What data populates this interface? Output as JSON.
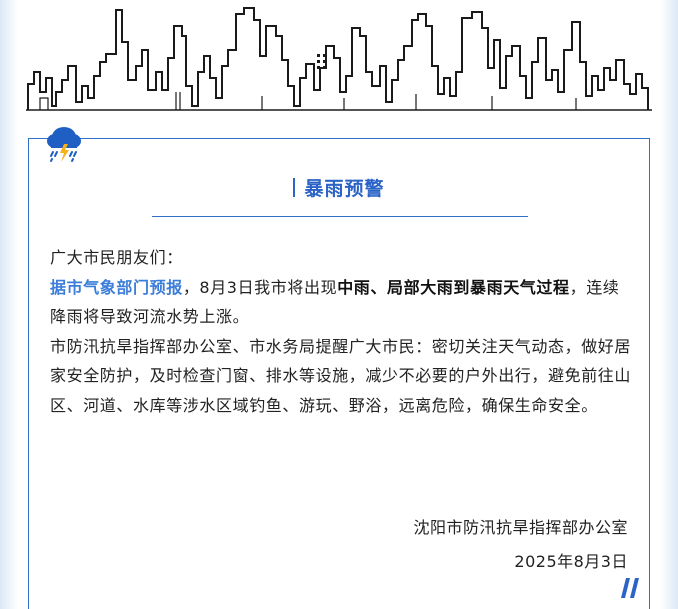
{
  "notice": {
    "title": "暴雨预警",
    "greeting": "广大市民朋友们：",
    "para1": {
      "highlight": "据市气象部门预报",
      "text_a": "，8月3日我市将出现",
      "bold": "中雨、局部大雨到暴雨天气过程",
      "text_b": "，连续降雨将导致河流水势上涨。"
    },
    "para2": "市防汛抗旱指挥部办公室、市水务局提醒广大市民：密切关注天气动态，做好居家安全防护，及时检查门窗、排水等设施，减少不必要的户外出行，避免前往山区、河道、水库等涉水区域钓鱼、游玩、野浴，远离危险，确保生命安全。",
    "signature": "沈阳市防汛抗旱指挥部办公室",
    "date": "2025年8月3日"
  },
  "colors": {
    "accent": "#2b64c6",
    "highlight": "#3b7dd8",
    "frame": "#2f6fc6",
    "skyline": "#1a1a1a"
  },
  "icons": [
    "rain-cloud-icon",
    "double-slash-icon"
  ]
}
